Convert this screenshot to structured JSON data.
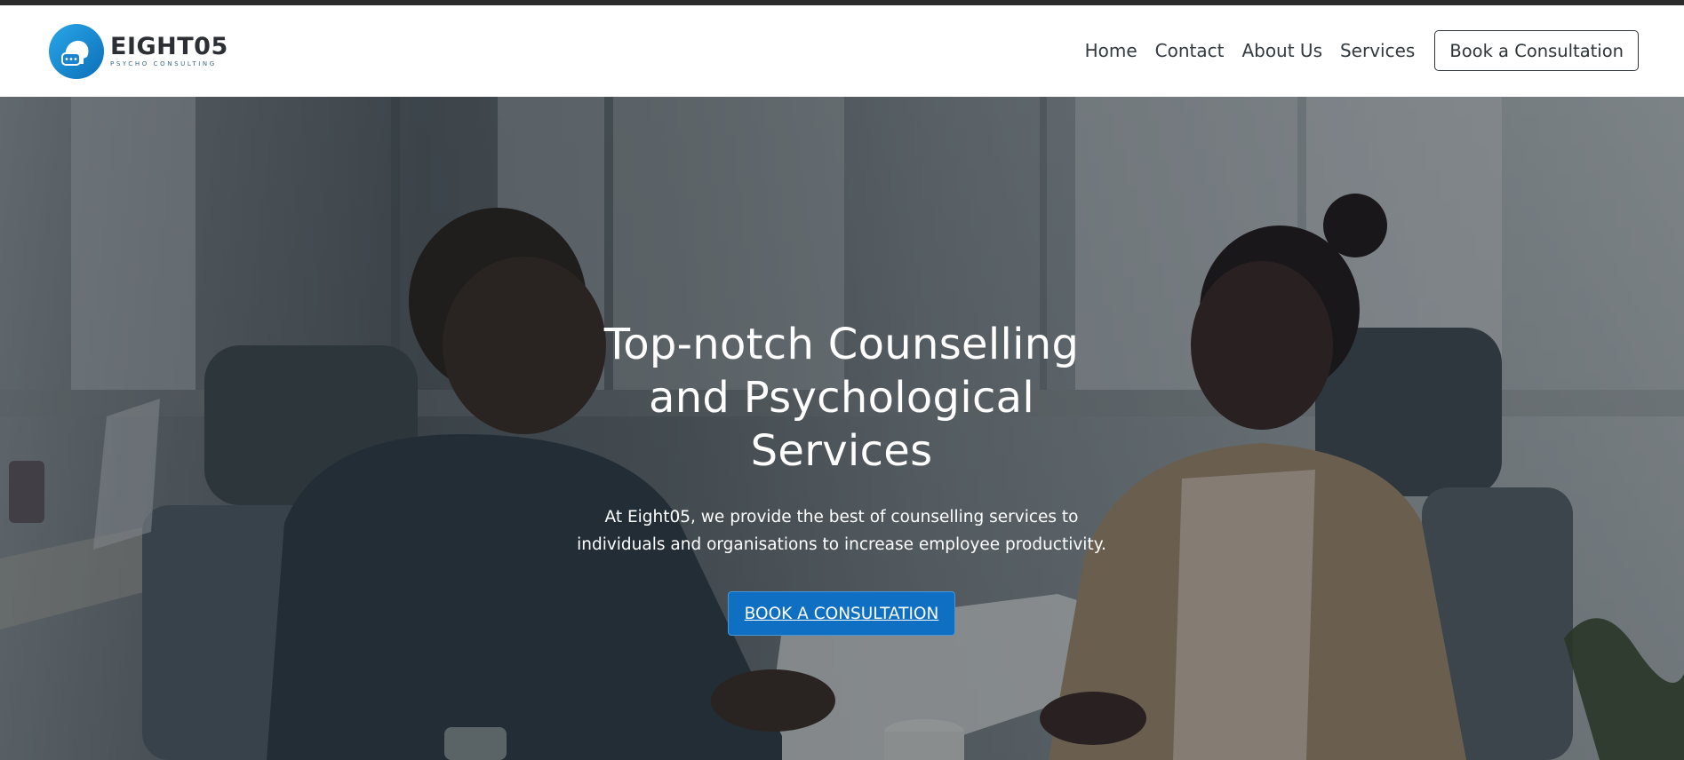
{
  "brand": {
    "name": "EIGHT05",
    "tagline": "PSYCHO CONSULTING",
    "logo_icon": "chat-bubble-head-icon",
    "accent_color": "#1e8fd6"
  },
  "nav": {
    "items": [
      {
        "label": "Home"
      },
      {
        "label": "Contact"
      },
      {
        "label": "About Us"
      },
      {
        "label": "Services"
      }
    ],
    "cta_label": "Book a Consultation"
  },
  "hero": {
    "title": "Top-notch Counselling and Psychological Services",
    "subtitle": "At Eight05, we provide the best of counselling services to individuals and organisations to increase employee productivity.",
    "cta_label": "BOOK A CONSULTATION",
    "cta_color": "#0f6fc3"
  }
}
